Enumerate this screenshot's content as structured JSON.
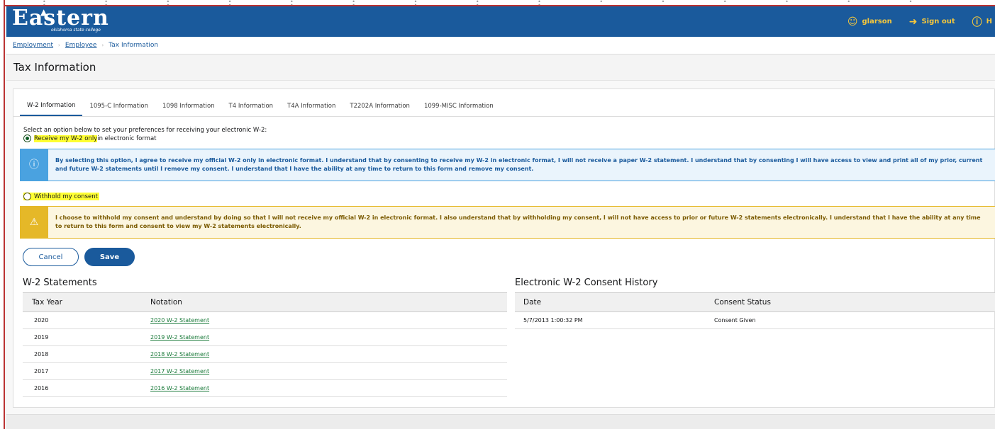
{
  "header": {
    "logo_word": "Eastern",
    "logo_sub": "oklahoma state college",
    "user": "glarson",
    "sign_out": "Sign out",
    "help": "H"
  },
  "breadcrumb": [
    "Employment",
    "Employee",
    "Tax Information"
  ],
  "page_title": "Tax Information",
  "tabs": [
    "W-2 Information",
    "1095-C Information",
    "1098 Information",
    "T4 Information",
    "T4A Information",
    "T2202A Information",
    "1099-MISC Information"
  ],
  "form": {
    "prompt": "Select an option below to set your preferences for receiving your electronic W-2:",
    "option1_highlight": "Receive my W-2 only",
    "option1_rest": " in electronic format",
    "option1_checked": true,
    "info_text": "By selecting this option, I agree to receive my official W-2 only in electronic format. I understand that by consenting to receive my W-2 in electronic format, I will not receive a paper W-2 statement. I understand that by consenting I will have access to view and print all of my prior, current and future W-2 statements until I remove my consent. I understand that I have the ability at any time to return to this form and remove my consent.",
    "option2": "Withhold my consent",
    "option2_checked": false,
    "warn_text": "I choose to withhold my consent and understand by doing so that I will not receive my official W-2 in electronic format. I also understand that by withholding my consent, I will not have access to prior or future W-2 statements electronically. I understand that I have the ability at any time to return to this form and consent to view my W-2 statements electronically.",
    "cancel": "Cancel",
    "save": "Save"
  },
  "statements": {
    "title": "W-2 Statements",
    "headers": [
      "Tax Year",
      "Notation"
    ],
    "rows": [
      {
        "year": "2020",
        "link": "2020 W-2 Statement"
      },
      {
        "year": "2019",
        "link": "2019 W-2 Statement"
      },
      {
        "year": "2018",
        "link": "2018 W-2 Statement"
      },
      {
        "year": "2017",
        "link": "2017 W-2 Statement"
      },
      {
        "year": "2016",
        "link": "2016 W-2 Statement"
      }
    ]
  },
  "history": {
    "title": "Electronic W-2 Consent History",
    "headers": [
      "Date",
      "Consent Status"
    ],
    "rows": [
      {
        "date": "5/7/2013 1:00:32 PM",
        "status": "Consent Given"
      }
    ]
  },
  "colors": {
    "brand": "#1a5a9c",
    "accent": "#f6c83c",
    "info": "#4aa2e0",
    "warning": "#e5b828",
    "highlight": "#ffff33"
  }
}
